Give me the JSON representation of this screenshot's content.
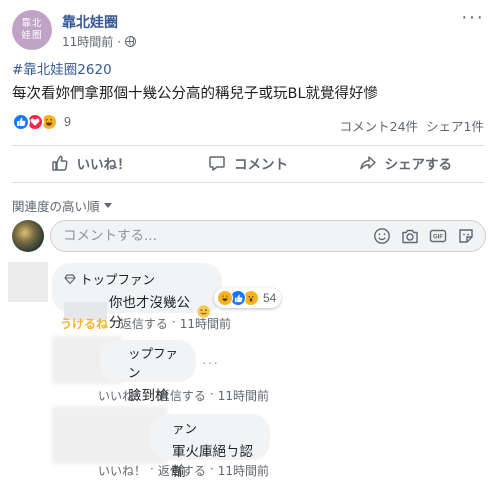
{
  "post": {
    "page_name": "靠北娃圈",
    "avatar_text": "靠北娃圈",
    "timestamp": "11時間前",
    "hashtag": "#靠北娃圈2620",
    "text": "每次看妳們拿那個十幾公分高的稱兒子或玩BL就覺得好慘",
    "reaction_count": "9",
    "comments_count": "コメント24件",
    "shares_count": "シェア1件"
  },
  "actions": {
    "like": "いいね！",
    "comment": "コメント",
    "share": "シェアする"
  },
  "sort": {
    "label": "関連度の高い順"
  },
  "composer": {
    "placeholder": "コメントする..."
  },
  "comments": [
    {
      "badge": "トップファン",
      "text": "你也才沒幾公分",
      "react_count": "54",
      "hot_label": "うけるね",
      "reply": "返信する",
      "time": "11時間前"
    },
    {
      "badge": "ップファン",
      "text": "臉到槍",
      "like": "いいね！",
      "reply": "返信する",
      "time": "11時間前"
    },
    {
      "badge": "ァン",
      "text": "軍火庫絕ㄅ認輸",
      "like": "いいね！",
      "reply": "返信する",
      "time": "11時間前"
    }
  ],
  "colors": {
    "link": "#365899",
    "like_blue": "#1877f2",
    "love_red": "#f0284a",
    "haha_yellow": "#f7b125"
  }
}
